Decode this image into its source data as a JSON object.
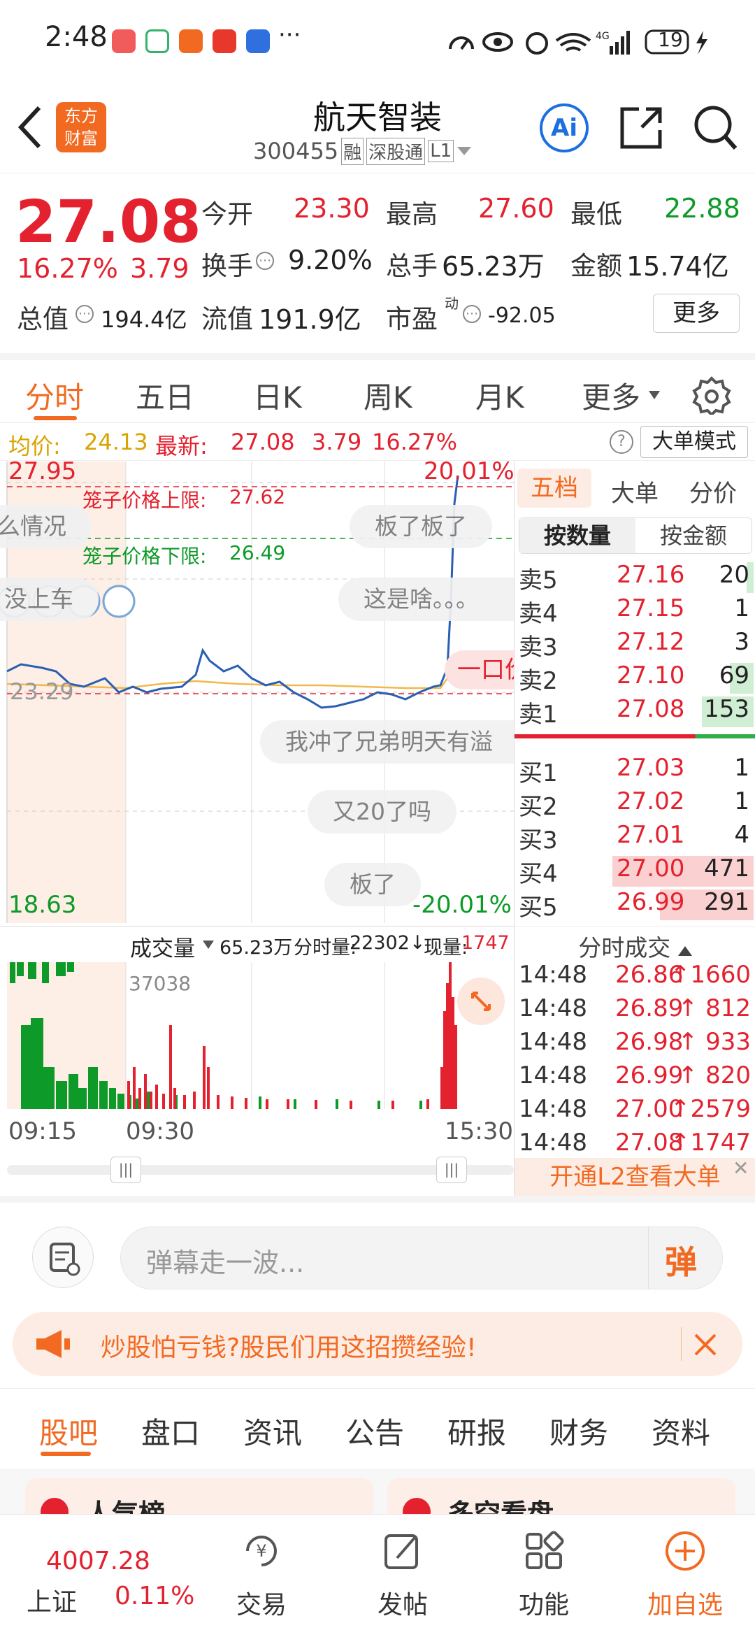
{
  "status_bar": {
    "time": "2:48",
    "battery": "19",
    "more": "···"
  },
  "header": {
    "logo_text": "东方\n财富",
    "stock_name": "航天智装",
    "stock_code": "300455",
    "tags": [
      "融",
      "深股通",
      "L1"
    ],
    "ai_label": "Ai"
  },
  "quote": {
    "price": "27.08",
    "change_pct": "16.27%",
    "change": "3.79",
    "open_label": "今开",
    "open": "23.30",
    "high_label": "最高",
    "high": "27.60",
    "low_label": "最低",
    "low": "22.88",
    "turnover_label": "换手",
    "turnover": "9.20%",
    "volume_label": "总手",
    "volume": "65.23万",
    "amount_label": "金额",
    "amount": "15.74亿",
    "mktcap_label": "总值",
    "mktcap": "194.4亿",
    "float_label": "流值",
    "float": "191.9亿",
    "pe_label": "市盈",
    "pe_sup": "动",
    "pe": "-92.05",
    "more_button": "更多"
  },
  "tabs": [
    "分时",
    "五日",
    "日K",
    "周K",
    "月K",
    "更多"
  ],
  "chart_info": {
    "avg_label": "均价:",
    "avg": "24.13",
    "latest_label": "最新:",
    "latest": "27.08",
    "latest_change": "3.79",
    "latest_pct": "16.27%",
    "big_order_mode": "大单模式"
  },
  "chart": {
    "price_high": "27.95",
    "price_low": "18.63",
    "pct_high": "20.01%",
    "pct_low": "-20.01%",
    "prev_close": "23.29",
    "cage_upper_label": "笼子价格上限:",
    "cage_upper": "27.62",
    "cage_lower_label": "笼子价格下限:",
    "cage_lower": "26.49",
    "one_click": "一口价",
    "time_labels": [
      "09:15",
      "09:30",
      "15:30"
    ],
    "volume_label": "成交量",
    "volume_total": "65.23万",
    "period_volume_label": "分时量:",
    "period_volume": "22302↓",
    "current_volume_label": "现量:",
    "current_volume": "1747",
    "volume_max": "37038"
  },
  "danmaku": [
    "么情况",
    "板了板了",
    "没上车",
    "这是啥。。。",
    "我冲了兄弟明天有溢",
    "又20了吗",
    "板了"
  ],
  "order_book": {
    "tabs": [
      "五档",
      "大单",
      "分价"
    ],
    "subtabs": [
      "按数量",
      "按金额"
    ],
    "asks": [
      {
        "label": "卖5",
        "price": "27.16",
        "qty": "20",
        "fill": 0.03
      },
      {
        "label": "卖4",
        "price": "27.15",
        "qty": "1",
        "fill": 0.0
      },
      {
        "label": "卖3",
        "price": "27.12",
        "qty": "3",
        "fill": 0.0
      },
      {
        "label": "卖2",
        "price": "27.10",
        "qty": "69",
        "fill": 0.1
      },
      {
        "label": "卖1",
        "price": "27.08",
        "qty": "153",
        "fill": 0.22
      }
    ],
    "bids": [
      {
        "label": "买1",
        "price": "27.03",
        "qty": "1",
        "fill": 0.0
      },
      {
        "label": "买2",
        "price": "27.02",
        "qty": "1",
        "fill": 0.0
      },
      {
        "label": "买3",
        "price": "27.01",
        "qty": "4",
        "fill": 0.0
      },
      {
        "label": "买4",
        "price": "27.00",
        "qty": "471",
        "fill": 0.6
      },
      {
        "label": "买5",
        "price": "26.99",
        "qty": "291",
        "fill": 0.4
      }
    ],
    "trades_title": "分时成交",
    "trades": [
      {
        "time": "14:48",
        "price": "26.86",
        "qty": "↑1660"
      },
      {
        "time": "14:48",
        "price": "26.89",
        "qty": "↑ 812"
      },
      {
        "time": "14:48",
        "price": "26.98",
        "qty": "↑ 933"
      },
      {
        "time": "14:48",
        "price": "26.99",
        "qty": "↑ 820"
      },
      {
        "time": "14:48",
        "price": "27.00",
        "qty": "↑2579"
      },
      {
        "time": "14:48",
        "price": "27.08",
        "qty": "↑1747"
      }
    ],
    "l2_banner": "开通L2查看大单"
  },
  "comment": {
    "placeholder": "弹幕走一波...",
    "send_label": "弹"
  },
  "ad": {
    "text": "炒股怕亏钱?股民们用这招攒经验!"
  },
  "bottom_tabs": [
    "股吧",
    "盘口",
    "资讯",
    "公告",
    "研报",
    "财务",
    "资料"
  ],
  "cards": [
    "人气榜",
    "多空看盘"
  ],
  "navbar": {
    "index_value": "4007.28",
    "index_name": "上证",
    "index_pct": "0.11%",
    "items": [
      "交易",
      "发帖",
      "功能",
      "加自选"
    ]
  }
}
